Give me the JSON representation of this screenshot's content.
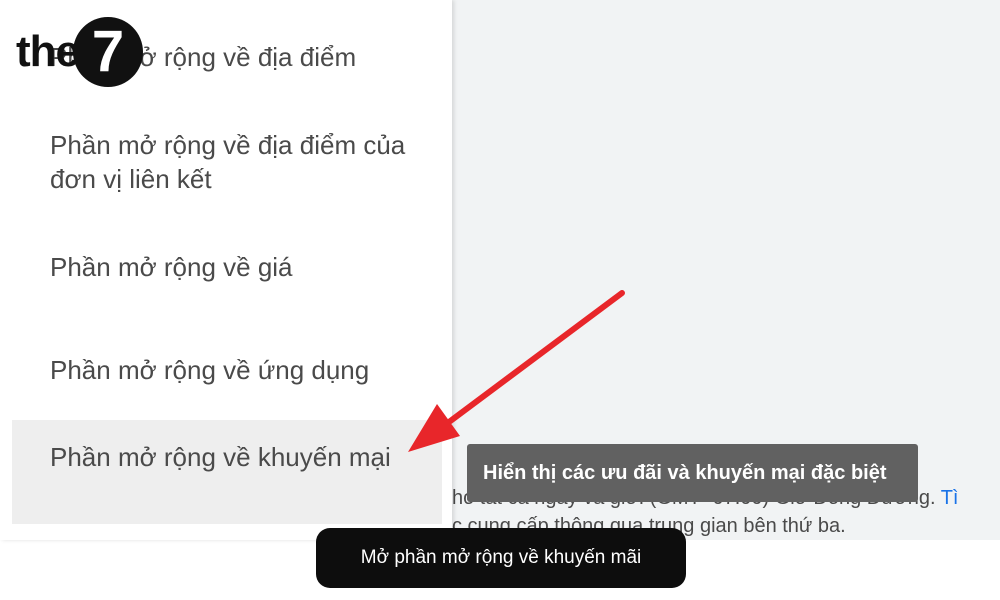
{
  "logo": {
    "word": "the",
    "badge": "7"
  },
  "sidebar": {
    "items": [
      {
        "label": "Phần mở rộng về địa điểm"
      },
      {
        "label": "Phần mở rộng về địa điểm của đơn vị liên kết"
      },
      {
        "label": "Phần mở rộng về giá"
      },
      {
        "label": "Phần mở rộng về ứng dụng"
      },
      {
        "label": "Phần mở rộng về khuyến mại"
      }
    ]
  },
  "background": {
    "line1": "ho tất cả ngày và giờ. (GMT+07:00) Giờ Đông Dương.",
    "line1_link": "Tì",
    "line2": "c cung cấp thông qua trung gian bên thứ ba."
  },
  "tooltip": {
    "text": "Hiển thị các ưu đãi và khuyến mại đặc biệt"
  },
  "annotation": {
    "arrow_color": "#e8262a"
  },
  "caption": {
    "text": "Mở phần mở rộng về khuyến mãi"
  },
  "colors": {
    "tooltip_bg": "#616161",
    "caption_bg": "#0d0d0d",
    "link": "#1a73e8"
  }
}
